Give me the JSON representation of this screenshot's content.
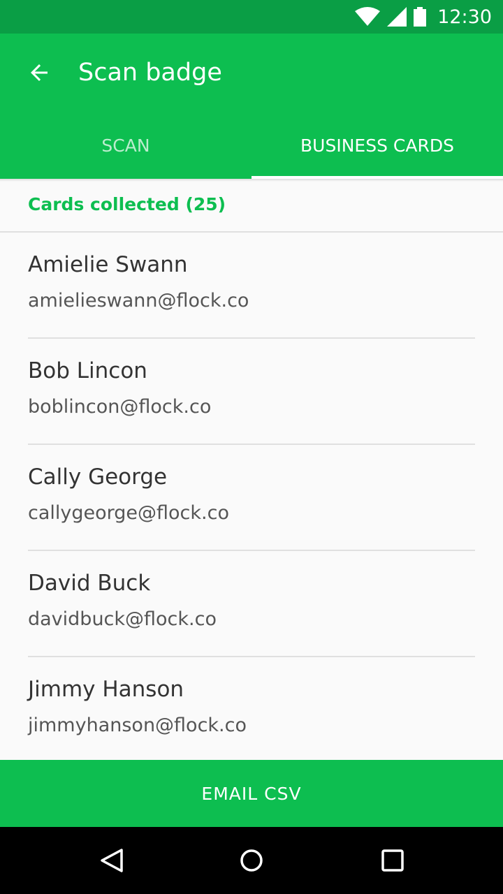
{
  "status_bar": {
    "time": "12:30",
    "icons": [
      "wifi-icon",
      "signal-icon",
      "battery-icon"
    ]
  },
  "app_bar": {
    "title": "Scan badge",
    "back_icon": "arrow-back-icon"
  },
  "tabs": [
    {
      "label": "SCAN",
      "selected": false
    },
    {
      "label": "BUSINESS CARDS",
      "selected": true
    }
  ],
  "subheader": {
    "label": "Cards collected (25)"
  },
  "cards": [
    {
      "name": "Amielie Swann",
      "email": "amielieswann@flock.co"
    },
    {
      "name": "Bob Lincon",
      "email": "boblincon@flock.co"
    },
    {
      "name": "Cally George",
      "email": "callygeorge@flock.co"
    },
    {
      "name": "David Buck",
      "email": "davidbuck@flock.co"
    },
    {
      "name": "Jimmy Hanson",
      "email": "jimmyhanson@flock.co"
    }
  ],
  "action": {
    "label": "EMAIL CSV"
  },
  "nav_bar": {
    "icons": [
      "back-triangle-icon",
      "home-circle-icon",
      "recents-square-icon"
    ]
  },
  "colors": {
    "primary": "#0dbe50",
    "primary_dark": "#0a9e45",
    "text_primary": "#333333",
    "text_secondary": "#555555",
    "divider": "#e0e0e0",
    "background": "#fafafa"
  }
}
